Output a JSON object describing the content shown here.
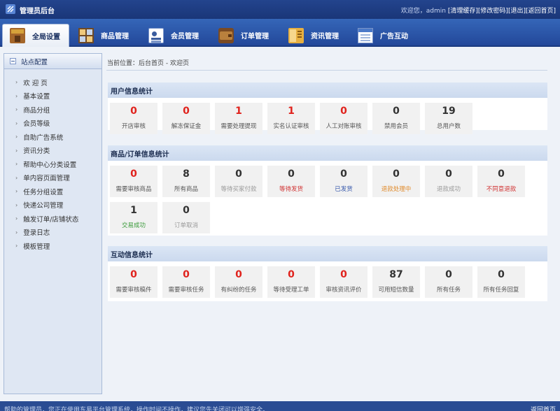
{
  "app": {
    "title": "管理员后台",
    "greeting": "欢迎您，",
    "username": "admin",
    "links": [
      "[清理缓存]",
      "[修改密码]",
      "[退出]",
      "[返回首页]"
    ]
  },
  "nav": {
    "tabs": [
      {
        "label": "全局设置",
        "icon": "store-icon",
        "active": true
      },
      {
        "label": "商品管理",
        "icon": "grid-icon"
      },
      {
        "label": "会员管理",
        "icon": "member-card-icon"
      },
      {
        "label": "订单管理",
        "icon": "wallet-icon"
      },
      {
        "label": "资讯管理",
        "icon": "folder-icon"
      },
      {
        "label": "广告互动",
        "icon": "window-icon"
      }
    ]
  },
  "sidebar": {
    "header": "站点配置",
    "items": [
      "欢 迎 页",
      "基本设置",
      "商品分组",
      "会员等级",
      "自助广告系统",
      "资讯分类",
      "帮助中心分类设置",
      "单内容页面管理",
      "任务分组设置",
      "快递公司管理",
      "触发订单/店铺状态",
      "登录日志",
      "模板管理"
    ]
  },
  "breadcrumb": "当前位置：后台首页 - 欢迎页",
  "sections": [
    {
      "title": "用户信息统计",
      "rows": [
        [
          {
            "value": "0",
            "label": "开店审核",
            "num_color": "#e0231d",
            "label_color": "#555555"
          },
          {
            "value": "0",
            "label": "解冻保证金",
            "num_color": "#e0231d",
            "label_color": "#555555"
          },
          {
            "value": "1",
            "label": "需要处理提现",
            "num_color": "#e0231d",
            "label_color": "#555555"
          },
          {
            "value": "1",
            "label": "实名认证审核",
            "num_color": "#e0231d",
            "label_color": "#555555"
          },
          {
            "value": "0",
            "label": "人工对账审核",
            "num_color": "#e0231d",
            "label_color": "#555555"
          },
          {
            "value": "0",
            "label": "禁用会员",
            "num_color": "#333333",
            "label_color": "#555555"
          },
          {
            "value": "19",
            "label": "总用户数",
            "num_color": "#333333",
            "label_color": "#555555"
          }
        ]
      ]
    },
    {
      "title": "商品/订单信息统计",
      "rows": [
        [
          {
            "value": "0",
            "label": "需要审核商品",
            "num_color": "#e0231d",
            "label_color": "#555555"
          },
          {
            "value": "8",
            "label": "所有商品",
            "num_color": "#333333",
            "label_color": "#555555"
          },
          {
            "value": "0",
            "label": "等待买家付款",
            "num_color": "#333333",
            "label_color": "#999999"
          },
          {
            "value": "0",
            "label": "等待发货",
            "num_color": "#333333",
            "label_color": "#d03030"
          },
          {
            "value": "0",
            "label": "已发货",
            "num_color": "#333333",
            "label_color": "#3355aa"
          },
          {
            "value": "0",
            "label": "退款处理中",
            "num_color": "#333333",
            "label_color": "#e08a2a"
          },
          {
            "value": "0",
            "label": "退款成功",
            "num_color": "#333333",
            "label_color": "#999999"
          },
          {
            "value": "0",
            "label": "不同意退款",
            "num_color": "#333333",
            "label_color": "#d03030"
          }
        ],
        [
          {
            "value": "1",
            "label": "交易成功",
            "num_color": "#333333",
            "label_color": "#3a9a3a"
          },
          {
            "value": "0",
            "label": "订单取消",
            "num_color": "#333333",
            "label_color": "#999999"
          }
        ]
      ]
    },
    {
      "title": "互动信息统计",
      "rows": [
        [
          {
            "value": "0",
            "label": "需要审核稿件",
            "num_color": "#e0231d",
            "label_color": "#555555"
          },
          {
            "value": "0",
            "label": "需要审核任务",
            "num_color": "#e0231d",
            "label_color": "#555555"
          },
          {
            "value": "0",
            "label": "有纠纷的任务",
            "num_color": "#e0231d",
            "label_color": "#555555"
          },
          {
            "value": "0",
            "label": "等待受理工单",
            "num_color": "#e0231d",
            "label_color": "#555555"
          },
          {
            "value": "0",
            "label": "审核资讯评价",
            "num_color": "#e0231d",
            "label_color": "#555555"
          },
          {
            "value": "87",
            "label": "可用短信数量",
            "num_color": "#333333",
            "label_color": "#555555"
          },
          {
            "value": "0",
            "label": "所有任务",
            "num_color": "#333333",
            "label_color": "#555555"
          },
          {
            "value": "0",
            "label": "所有任务回复",
            "num_color": "#333333",
            "label_color": "#555555"
          }
        ]
      ]
    }
  ],
  "footer": {
    "text": "帮助的管理员，您正在使用东易平台管理系统，操作时间不操作，建议您先关闭可以增强安全。",
    "home": "返回首页"
  }
}
